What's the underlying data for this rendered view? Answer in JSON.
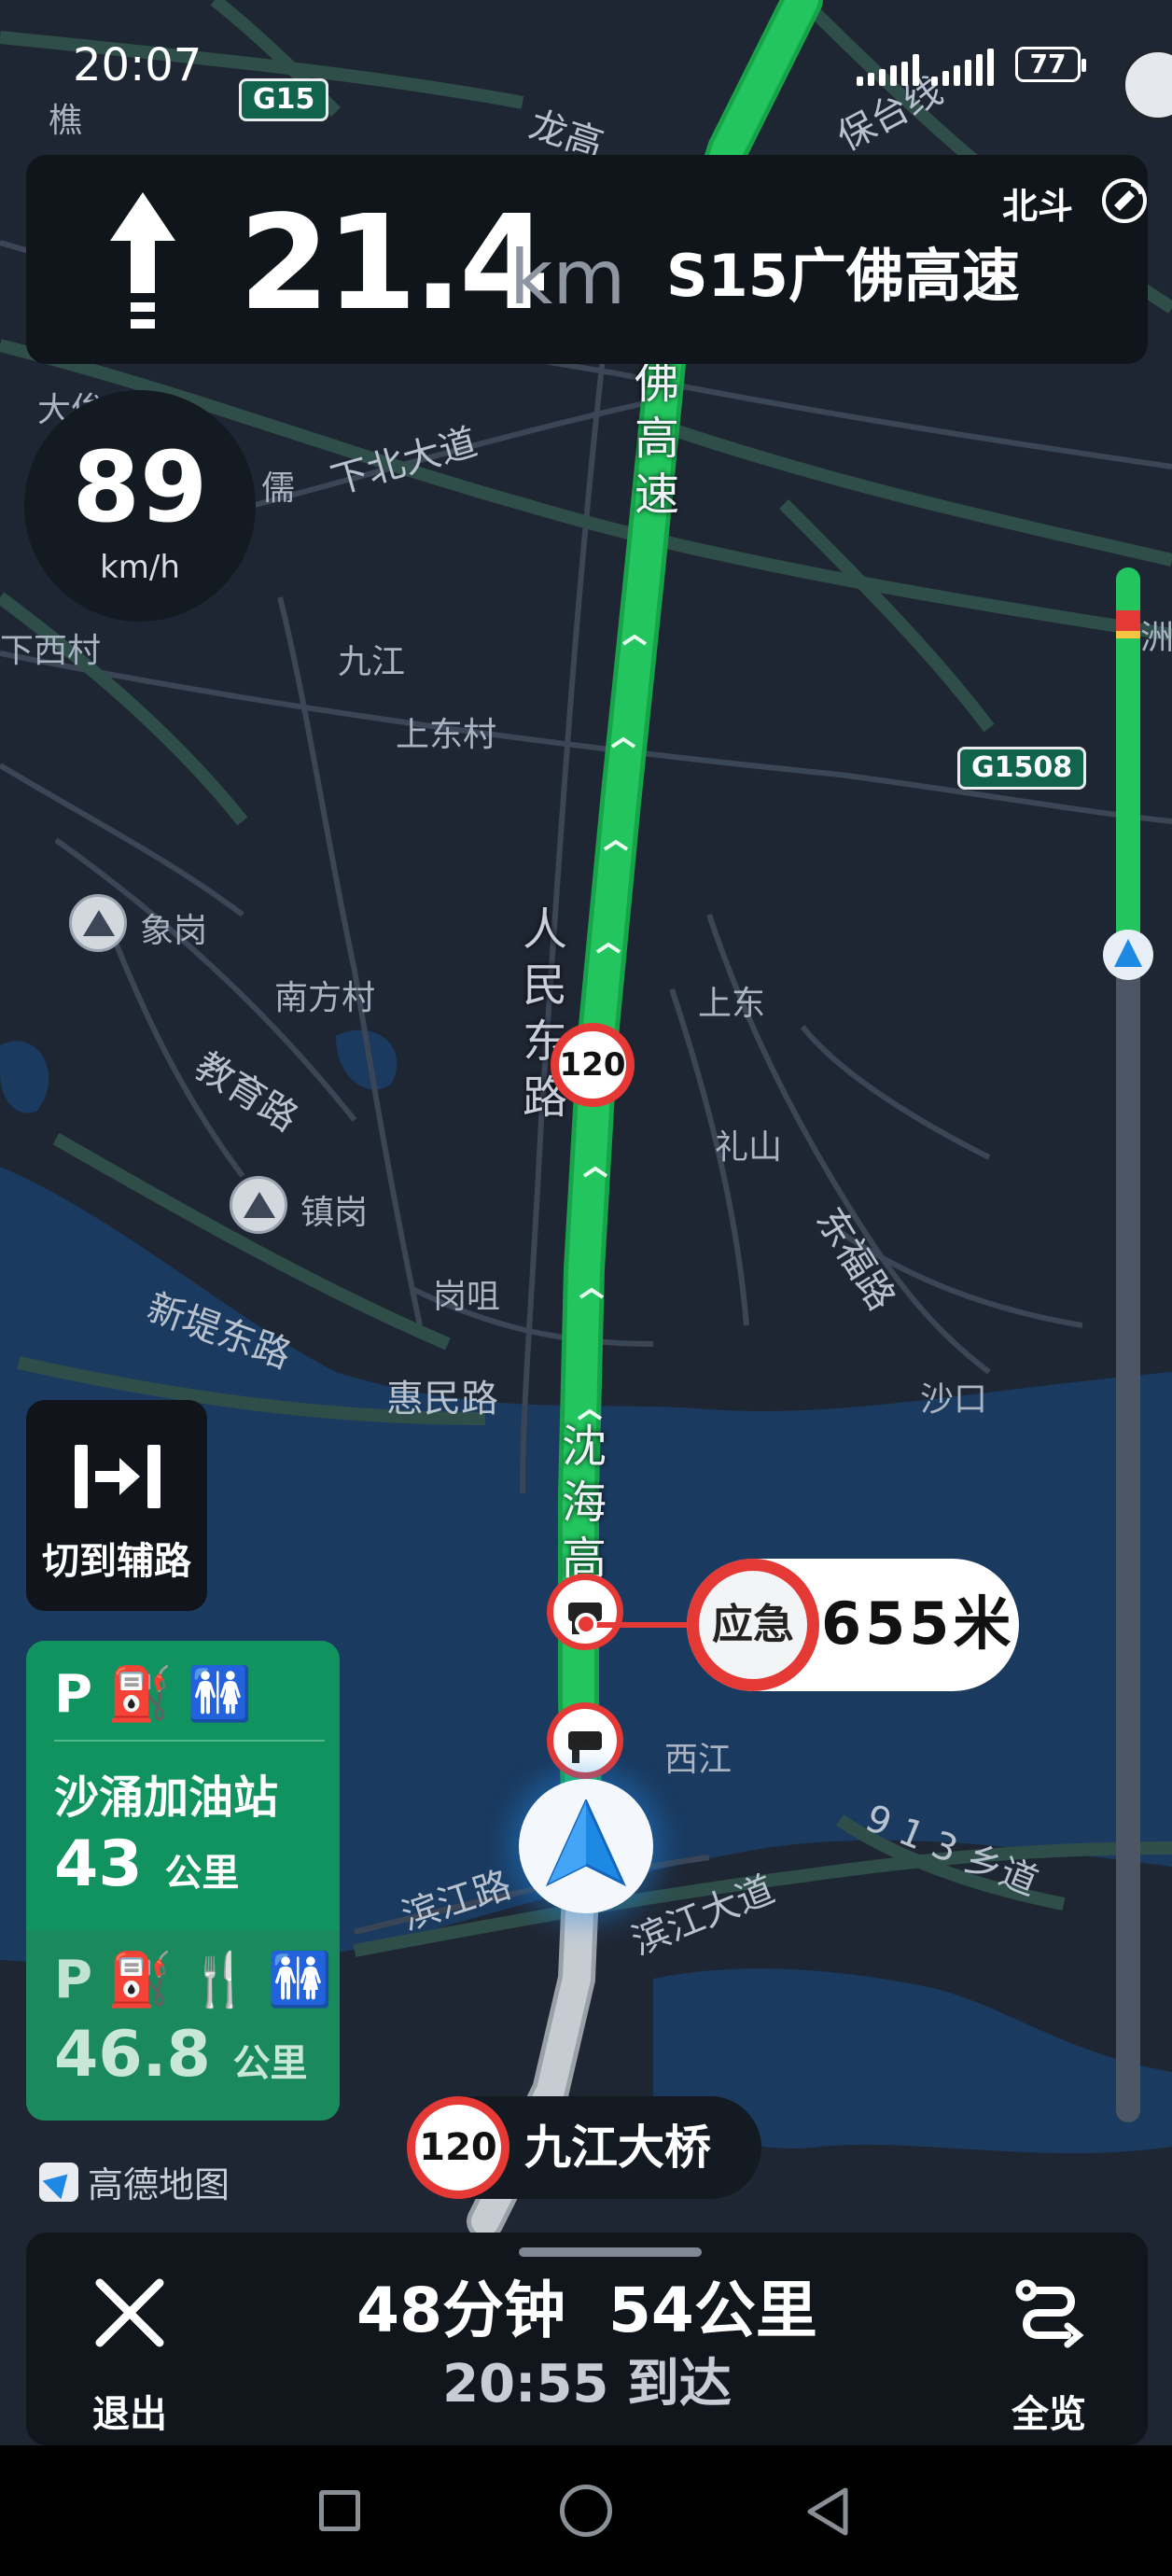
{
  "status_bar": {
    "time": "20:07",
    "battery": "77"
  },
  "guidance": {
    "distance_value": "21.4",
    "distance_unit": "km",
    "road_name": "S15广佛高速",
    "positioning": "北斗"
  },
  "speed": {
    "value": "89",
    "unit": "km/h"
  },
  "map": {
    "labels": {
      "jiao": "樵",
      "longgao": "龙高",
      "baotai": "保台线",
      "dashi": "大侔",
      "ru": "儒",
      "xiabei": "下北大道",
      "xiaxicun": "下西村",
      "jiujiang": "九江",
      "shangdongcun": "上东村",
      "xianggang": "象岗",
      "nanfangcun": "南方村",
      "shangdong": "上东",
      "jiaoyulu": "教育路",
      "lishan": "礼山",
      "zhengang": "镇岗",
      "dongfulu": "东福路",
      "gangju": "岗咀",
      "xindidonglu": "新堤东路",
      "huiminlu": "惠民路",
      "shakou": "沙口",
      "xijiang": "西江",
      "binjianglu": "滨江路",
      "binjiangdadao": "滨江大道",
      "road913": "9 1 3 乡道",
      "rightedge": "洲沙",
      "renmin_vertical": "人民东路",
      "gaosu_top": "佛高速",
      "shenhai_vertical": "沈海高速"
    },
    "shields": {
      "g15": "G15",
      "g1508": "G1508"
    },
    "speed_limit_on_route": "120",
    "emergency": {
      "badge": "应急",
      "distance": "655米"
    }
  },
  "side_road": {
    "label": "切到辅路"
  },
  "service_areas": [
    {
      "name": "沙涌加油站",
      "distance_value": "43",
      "distance_unit": "公里"
    },
    {
      "distance_value": "46.8",
      "distance_unit": "公里"
    }
  ],
  "logo": {
    "text": "高德地图"
  },
  "bridge": {
    "limit": "120",
    "name": "九江大桥"
  },
  "trip": {
    "duration": "48分钟",
    "distance": "54公里",
    "eta": "20:55 到达"
  },
  "bottom_actions": {
    "exit_label": "退出",
    "overview_label": "全览"
  },
  "colors": {
    "route_green": "#22c55e",
    "water": "#1a3a5f",
    "land": "#1f2633",
    "alert_red": "#e53935",
    "service_green": "#10935f"
  }
}
